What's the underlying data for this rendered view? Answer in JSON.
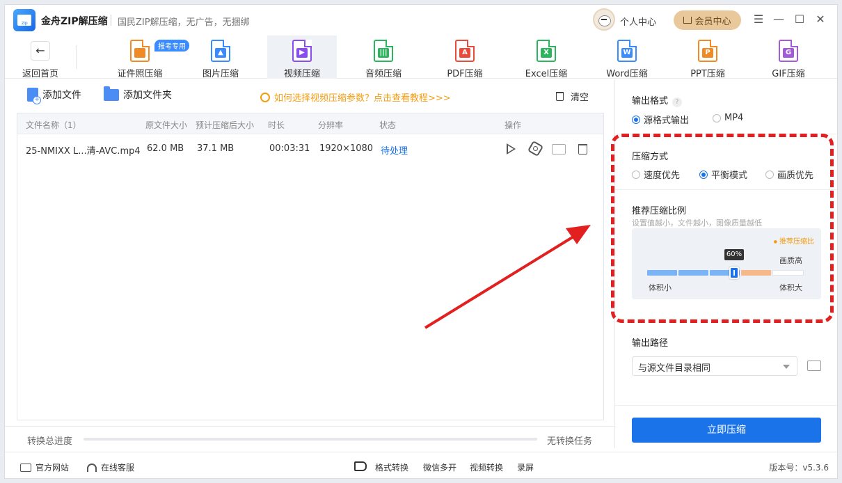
{
  "titlebar": {
    "app_name": "金舟ZIP解压缩",
    "slogan": "国民ZIP解压缩，无广告，无捆绑",
    "user_center": "个人中心",
    "vip_label": "会员中心",
    "window_controls": [
      "menu-icon",
      "minimize-icon",
      "maximize-icon",
      "close-icon"
    ]
  },
  "nav": {
    "back_label": "返回首页",
    "badge": "报考专用",
    "tabs": [
      {
        "label": "证件照压缩",
        "icon": "id-photo-icon",
        "color": "#f08a24",
        "active": false
      },
      {
        "label": "图片压缩",
        "icon": "image-file-icon",
        "color": "#3a8bff",
        "active": false
      },
      {
        "label": "视频压缩",
        "icon": "video-file-icon",
        "color": "#8a4df0",
        "active": true
      },
      {
        "label": "音频压缩",
        "icon": "audio-file-icon",
        "color": "#2db55d",
        "active": false
      },
      {
        "label": "PDF压缩",
        "icon": "pdf-file-icon",
        "color": "#e84a3c",
        "active": false
      },
      {
        "label": "Excel压缩",
        "icon": "excel-file-icon",
        "color": "#2db55d",
        "active": false
      },
      {
        "label": "Word压缩",
        "icon": "word-file-icon",
        "color": "#3a8bff",
        "active": false
      },
      {
        "label": "PPT压缩",
        "icon": "ppt-file-icon",
        "color": "#f08a24",
        "active": false
      },
      {
        "label": "GIF压缩",
        "icon": "gif-file-icon",
        "color": "#a25bd9",
        "active": false
      }
    ]
  },
  "actions": {
    "add_file": "添加文件",
    "add_folder": "添加文件夹",
    "tutorial": "如何选择视频压缩参数？点击查看教程>>>",
    "clear": "清空"
  },
  "table": {
    "headers": [
      "文件名称（1）",
      "原文件大小",
      "预计压缩后大小",
      "时长",
      "分辨率",
      "状态",
      "操作"
    ],
    "rows": [
      {
        "name": "25-NMIXX L...清-AVC.mp4",
        "size": "62.0 MB",
        "compressed": "37.1 MB",
        "duration": "00:03:31",
        "resolution": "1920×1080",
        "status": "待处理"
      }
    ]
  },
  "progress": {
    "label": "转换总进度",
    "status": "无转换任务",
    "value": 0
  },
  "settings": {
    "output_format": {
      "title": "输出格式",
      "help": "?",
      "options": [
        "源格式输出",
        "MP4"
      ],
      "selected": 0
    },
    "compress_mode": {
      "title": "压缩方式",
      "options": [
        "速度优先",
        "平衡模式",
        "画质优先"
      ],
      "selected": 1
    },
    "ratio": {
      "title": "推荐压缩比例",
      "hint": "设置值越小，文件越小，图像质量越低",
      "recommended_label": "推荐压缩比",
      "value_label": "60%",
      "value": 60,
      "quality_label": "画质高",
      "min_label": "体积小",
      "max_label": "体积大"
    },
    "output_path": {
      "title": "输出路径",
      "value": "与源文件目录相同"
    },
    "compress_button": "立即压缩"
  },
  "footer": {
    "website": "官方网站",
    "service": "在线客服",
    "links": [
      "格式转换",
      "微信多开",
      "视频转换",
      "录屏"
    ],
    "version": "版本号：v5.3.6"
  },
  "colors": {
    "accent": "#1a73e8",
    "annotation": "#e32020",
    "vip": "#e9c99c"
  }
}
